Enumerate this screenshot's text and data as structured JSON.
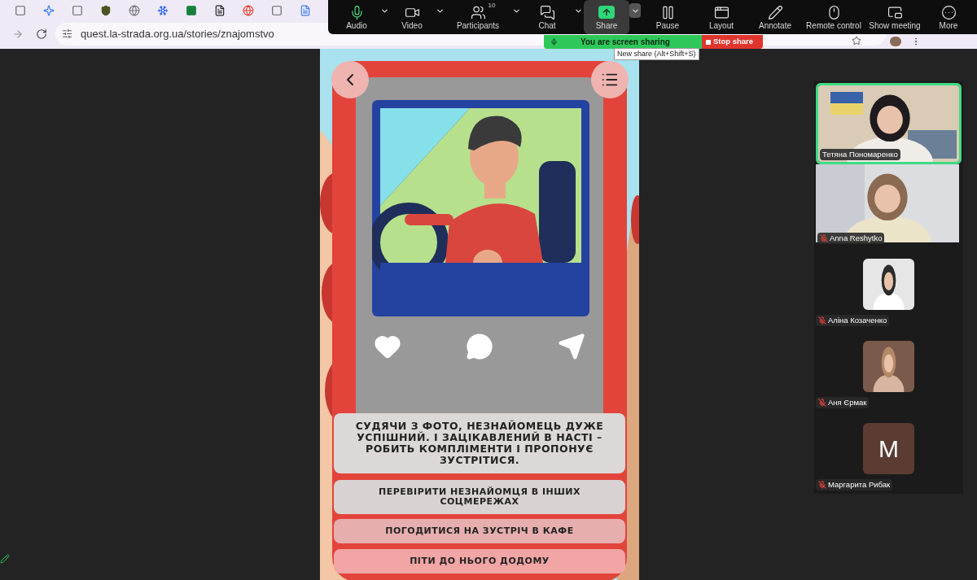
{
  "browser": {
    "url": "quest.la-strada.org.ua/stories/znajomstvo"
  },
  "meeting_toolbar": {
    "items": [
      {
        "label": "Audio",
        "kind": "audio",
        "selected": false,
        "menu": true
      },
      {
        "label": "Video",
        "kind": "video",
        "selected": false,
        "menu": true
      },
      {
        "label": "Participants",
        "kind": "participants",
        "selected": false,
        "menu": true,
        "badge": "10"
      },
      {
        "label": "Chat",
        "kind": "chat",
        "selected": false,
        "menu": true
      },
      {
        "label": "Share",
        "kind": "share",
        "selected": true,
        "menu": true
      },
      {
        "label": "Pause",
        "kind": "pause",
        "selected": false,
        "menu": false
      },
      {
        "label": "Layout",
        "kind": "layout",
        "selected": false,
        "menu": false
      },
      {
        "label": "Annotate",
        "kind": "annotate",
        "selected": false,
        "menu": false
      },
      {
        "label": "Remote control",
        "kind": "remote",
        "selected": false,
        "menu": false
      },
      {
        "label": "Show meeting",
        "kind": "show",
        "selected": false,
        "menu": false
      },
      {
        "label": "More",
        "kind": "more",
        "selected": false,
        "menu": false
      }
    ]
  },
  "share_banner": {
    "text": "You are screen sharing",
    "stop_label": "Stop share"
  },
  "tooltip": "New share (Alt+Shift+S)",
  "quest": {
    "story": "СУДЯЧИ З ФОТО, НЕЗНАЙОМЕЦЬ ДУЖЕ УСПІШНИЙ. І ЗАЦІКАВЛЕНИЙ В НАСТІ – РОБИТЬ КОМПЛІМЕНТИ І ПРОПОНУЄ ЗУСТРІТИСЯ.",
    "options": [
      {
        "label": "ПЕРЕВІРИТИ НЕЗНАЙОМЦЯ В ІНШИХ СОЦМЕРЕЖАХ",
        "color": "#d9d2d2"
      },
      {
        "label": "ПОГОДИТИСЯ НА ЗУСТРІЧ В КАФЕ",
        "color": "#e6aeae"
      },
      {
        "label": "ПІТИ ДО НЬОГО ДОДОМУ",
        "color": "#f2a5a5"
      }
    ]
  },
  "participants": [
    {
      "name": "Тетяна Пономаренко",
      "kind": "video",
      "muted": false,
      "speaking": true
    },
    {
      "name": "Anna Reshytko",
      "kind": "video",
      "muted": true,
      "speaking": false
    },
    {
      "name": "Аліна Козаченко",
      "muted": true
    },
    {
      "name": "Аня Єрмак",
      "muted": true
    },
    {
      "name": "Маргарита Рибак",
      "kind": "initial",
      "initial": "M",
      "muted": true
    }
  ]
}
